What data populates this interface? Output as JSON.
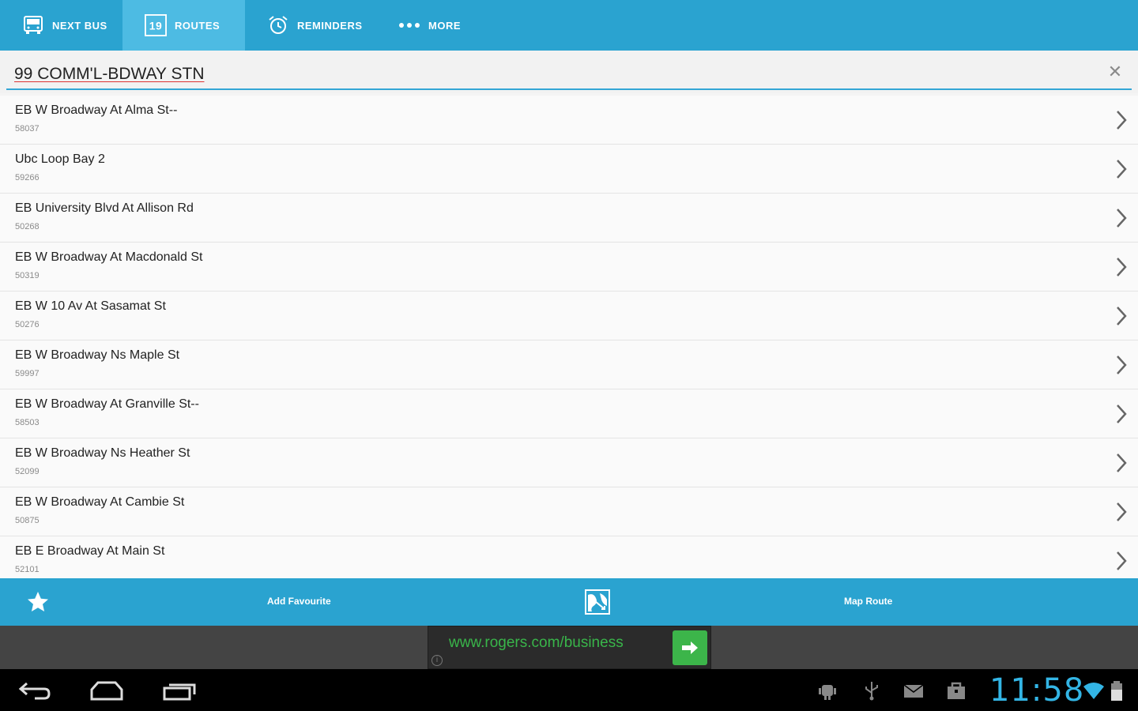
{
  "tabs": [
    {
      "label": "NEXT BUS",
      "icon": "bus-icon"
    },
    {
      "label": "ROUTES",
      "icon": "route-number-icon",
      "badge": "19"
    },
    {
      "label": "REMINDERS",
      "icon": "alarm-clock-icon"
    },
    {
      "label": "MORE",
      "icon": "ellipsis-icon"
    }
  ],
  "active_tab": "ROUTES",
  "route_title": "99 COMM'L-BDWAY STN",
  "stops": [
    {
      "name": "EB W Broadway At Alma St--",
      "code": "58037"
    },
    {
      "name": "Ubc Loop Bay 2",
      "code": "59266"
    },
    {
      "name": "EB University Blvd At Allison Rd",
      "code": "50268"
    },
    {
      "name": "EB W Broadway At Macdonald St",
      "code": "50319"
    },
    {
      "name": "EB W 10 Av At Sasamat St",
      "code": "50276"
    },
    {
      "name": "EB W Broadway Ns Maple St",
      "code": "59997"
    },
    {
      "name": "EB W Broadway At Granville St--",
      "code": "58503"
    },
    {
      "name": "EB W Broadway Ns Heather St",
      "code": "52099"
    },
    {
      "name": "EB W Broadway At Cambie St",
      "code": "50875"
    },
    {
      "name": "EB E Broadway At Main St",
      "code": "52101"
    }
  ],
  "actions": {
    "add_favourite": "Add Favourite",
    "map_route": "Map Route"
  },
  "ad": {
    "url": "www.rogers.com/business",
    "info": "i"
  },
  "status": {
    "time": "11:58"
  },
  "colors": {
    "accent": "#2aa3d0",
    "accent_active": "#4dbbe3",
    "clock": "#33b5e5",
    "ad_green": "#3cb54a"
  }
}
